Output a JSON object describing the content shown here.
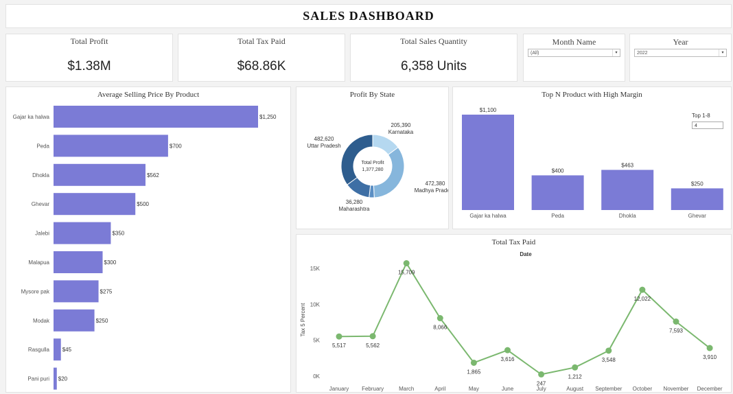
{
  "title": "SALES  DASHBOARD",
  "kpis": {
    "profit": {
      "label": "Total Profit",
      "value": "$1.38M"
    },
    "tax": {
      "label": "Total Tax Paid",
      "value": "$68.86K"
    },
    "qty": {
      "label": "Total Sales Quantity",
      "value": "6,358  Units"
    }
  },
  "filters": {
    "month": {
      "label": "Month Name",
      "value": "(All)"
    },
    "year": {
      "label": "Year",
      "value": "2022"
    }
  },
  "chart_data": [
    {
      "type": "bar",
      "orientation": "horizontal",
      "title": "Average Selling Price By Product",
      "categories": [
        "Gajar ka halwa",
        "Peda",
        "Dhokla",
        "Ghevar",
        "Jalebi",
        "Malapua",
        "Mysore pak",
        "Modak",
        "Rasgulla",
        "Pani puri"
      ],
      "values": [
        1250,
        700,
        562,
        500,
        350,
        300,
        275,
        250,
        45,
        20
      ],
      "labels": [
        "$1,250",
        "$700",
        "$562",
        "$500",
        "$350",
        "$300",
        "$275",
        "$250",
        "$45",
        "$20"
      ],
      "color": "#7b7bd6"
    },
    {
      "type": "pie",
      "title": "Profit By State",
      "center_label": "Total Profit",
      "center_value": "1,377,280",
      "slices": [
        {
          "name": "Karnataka",
          "value": 205390,
          "label": "205,390",
          "color": "#b5d8f0"
        },
        {
          "name": "Madhya Pradesh",
          "value": 472380,
          "label": "472,380",
          "color": "#86b6dc"
        },
        {
          "name": "Maharashtra",
          "value": 36280,
          "label": "36,280",
          "color": "#5b8fc4"
        },
        {
          "name": "Uttar Pradesh",
          "value": 482620,
          "label": "482,620",
          "color": "#2e5d8e"
        }
      ],
      "extra_slice": {
        "value": 180610,
        "color": "#3e6fa5"
      }
    },
    {
      "type": "bar",
      "title": "Top N Product with High Margin",
      "categories": [
        "Gajar ka halwa",
        "Peda",
        "Dhokla",
        "Ghevar"
      ],
      "values": [
        1100,
        400,
        463,
        250
      ],
      "labels": [
        "$1,100",
        "$400",
        "$463",
        "$250"
      ],
      "color": "#7b7bd6",
      "control": {
        "label": "Top 1-8",
        "value": "4"
      }
    },
    {
      "type": "line",
      "title": "Total Tax Paid",
      "subtitle": "Date",
      "ylabel": "Tax 5 Percent",
      "categories": [
        "January",
        "February",
        "March",
        "April",
        "May",
        "June",
        "July",
        "August",
        "September",
        "October",
        "November",
        "December"
      ],
      "values": [
        5517,
        5562,
        15709,
        8066,
        1865,
        3616,
        247,
        1212,
        3548,
        12022,
        7593,
        3910
      ],
      "labels": [
        "5,517",
        "5,562",
        "15,709",
        "8,066",
        "1,865",
        "3,616",
        "247",
        "1,212",
        "3,548",
        "12,022",
        "7,593",
        "3,910"
      ],
      "yticks": [
        {
          "v": 0,
          "label": "0K"
        },
        {
          "v": 5000,
          "label": "5K"
        },
        {
          "v": 10000,
          "label": "10K"
        },
        {
          "v": 15000,
          "label": "15K"
        }
      ],
      "ylim": [
        0,
        17000
      ],
      "color": "#7bb86f"
    }
  ]
}
